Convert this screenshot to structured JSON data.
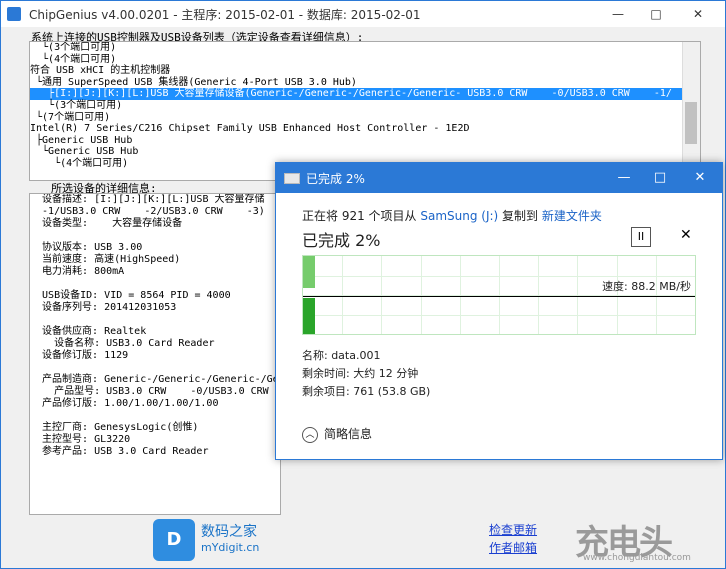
{
  "app": {
    "title": "ChipGenius v4.00.0201 - 主程序: 2015-02-01 - 数据库: 2015-02-01",
    "min": "—",
    "max": "□",
    "close": "✕"
  },
  "tree_section": {
    "label": "系统上连接的USB控制器及USB设备列表（选定设备查看详细信息）:",
    "lines": [
      "  └(3个端口可用)",
      "  └(4个端口可用)",
      "符合 USB xHCI 的主机控制器",
      " └通用 SuperSpeed USB 集线器(Generic 4-Port USB 3.0 Hub)",
      "   ├[I:][J:][K:][L:]USB 大容量存储设备(Generic-/Generic-/Generic-/Generic- USB3.0 CRW    -0/USB3.0 CRW    -1/",
      "   └(3个端口可用)",
      " └(7个端口可用)",
      "Intel(R) 7 Series/C216 Chipset Family USB Enhanced Host Controller - 1E2D",
      " ├Generic USB Hub",
      "  └Generic USB Hub",
      "    └(4个端口可用)"
    ],
    "selected_index": 4
  },
  "detail_section": {
    "label": "所选设备的详细信息:",
    "lines": [
      "  设备描述: [I:][J:][K:][L:]USB 大容量存储",
      "  -1/USB3.0 CRW    -2/USB3.0 CRW    -3)",
      "  设备类型:    大容量存储设备",
      "",
      "  协议版本: USB 3.00",
      "  当前速度: 高速(HighSpeed)",
      "  电力消耗: 800mA",
      "",
      "  USB设备ID: VID = 8564 PID = 4000",
      "  设备序列号: 201412031053",
      "",
      "  设备供应商: Realtek",
      "    设备名称: USB3.0 Card Reader",
      "  设备修订版: 1129",
      "",
      "  产品制造商: Generic-/Generic-/Generic-/Ge",
      "    产品型号: USB3.0 CRW    -0/USB3.0 CRW",
      "  产品修订版: 1.00/1.00/1.00/1.00",
      "",
      "  主控厂商: GenesysLogic(创惟)",
      "  主控型号: GL3220",
      "  参考产品: USB 3.0 Card Reader"
    ]
  },
  "footer": {
    "logo_letter": "D",
    "site_name": "数码之家",
    "site_url": "mYdigit.cn",
    "check_update": "检查更新",
    "author_email": "作者邮箱",
    "watermark": "充电头",
    "watermark_url": "www.chongdiantou.com"
  },
  "copy_dialog": {
    "title": "已完成 2%",
    "line_prefix": "正在将 921 个项目从 ",
    "source": "SamSung (J:)",
    "line_mid": " 复制到 ",
    "dest": "新建文件夹",
    "percent_text": "已完成 2%",
    "progress_fraction": 0.02,
    "pause_label": "II",
    "close_label": "✕",
    "speed": "速度: 88.2 MB/秒",
    "name": "名称: data.001",
    "time_left": "剩余时间: 大约 12 分钟",
    "items_left": "剩余项目: 761 (53.8 GB)",
    "less_info": "简略信息",
    "min": "—",
    "max": "□",
    "close": "✕"
  }
}
